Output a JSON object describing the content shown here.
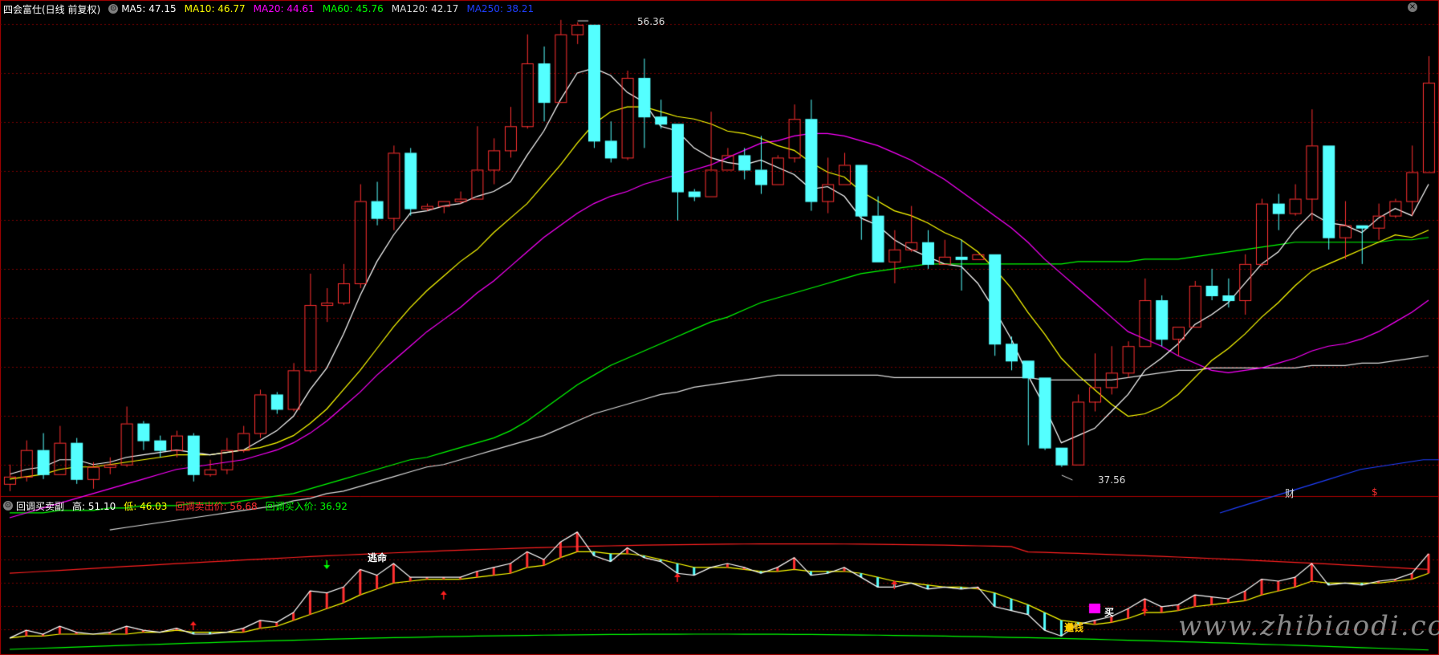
{
  "main_panel": {
    "title": "四会富仕(日线 前复权)",
    "ma": [
      {
        "label": "MA5: 47.15",
        "color": "#ffffff"
      },
      {
        "label": "MA10: 46.77",
        "color": "#ffff00"
      },
      {
        "label": "MA20: 44.61",
        "color": "#ff00ff"
      },
      {
        "label": "MA60: 45.76",
        "color": "#00ff00"
      },
      {
        "label": "MA120: 42.17",
        "color": "#dddddd"
      },
      {
        "label": "MA250: 38.21",
        "color": "#1f3fff"
      }
    ],
    "high_label": "56.36",
    "low_label": "37.56",
    "marker_cai": "财",
    "marker_dollar": "$"
  },
  "sub_panel": {
    "title": "回调买卖副",
    "high": "高: 51.10",
    "low": "低: 46.03",
    "sell_price": "回调卖出价: 56.68",
    "buy_price": "回调买入价: 36.92",
    "label_taoming": "逃命",
    "label_songqian": "送钱",
    "label_buy": "买"
  },
  "watermark": "www.zhibiaodi.com",
  "colors": {
    "up": "#ff3030",
    "down": "#54ffff",
    "grid": "#7a0000",
    "ma5": "#ffffff",
    "ma10": "#ffff00",
    "ma20": "#ff00ff",
    "ma60": "#00ff00",
    "ma120": "#dddddd",
    "ma250": "#1f3fff"
  },
  "candles": [
    [
      37.2,
      37.5,
      38.0,
      36.9
    ],
    [
      37.5,
      38.6,
      39.0,
      37.3
    ],
    [
      38.6,
      37.6,
      39.3,
      37.4
    ],
    [
      37.6,
      38.9,
      39.6,
      37.6
    ],
    [
      38.9,
      37.4,
      39.1,
      37.2
    ],
    [
      37.4,
      37.9,
      38.1,
      37.0
    ],
    [
      37.9,
      38.0,
      38.3,
      37.6
    ],
    [
      38.0,
      39.7,
      40.4,
      37.9
    ],
    [
      39.7,
      39.0,
      39.8,
      38.6
    ],
    [
      39.0,
      38.6,
      39.2,
      38.3
    ],
    [
      38.6,
      39.2,
      39.4,
      38.3
    ],
    [
      39.2,
      37.6,
      39.3,
      37.3
    ],
    [
      37.6,
      37.8,
      38.2,
      37.5
    ],
    [
      37.8,
      38.6,
      39.1,
      37.6
    ],
    [
      38.6,
      39.3,
      39.6,
      38.5
    ],
    [
      39.3,
      40.9,
      41.1,
      39.1
    ],
    [
      40.9,
      40.3,
      41.0,
      40.1
    ],
    [
      40.3,
      41.9,
      42.2,
      40.2
    ],
    [
      41.9,
      44.6,
      45.9,
      41.8
    ],
    [
      44.6,
      44.7,
      45.3,
      43.9
    ],
    [
      44.7,
      45.5,
      46.3,
      44.6
    ],
    [
      45.5,
      48.9,
      49.6,
      45.3
    ],
    [
      48.9,
      48.2,
      49.7,
      47.9
    ],
    [
      48.2,
      50.9,
      51.2,
      47.7
    ],
    [
      50.9,
      48.6,
      51.1,
      48.3
    ],
    [
      48.6,
      48.7,
      48.8,
      48.5
    ],
    [
      48.7,
      48.9,
      48.9,
      48.4
    ],
    [
      48.9,
      49.0,
      49.3,
      48.8
    ],
    [
      49.0,
      50.2,
      52.0,
      49.0
    ],
    [
      50.2,
      51.0,
      51.5,
      49.6
    ],
    [
      51.0,
      52.0,
      52.8,
      50.7
    ],
    [
      52.0,
      54.6,
      55.8,
      51.9
    ],
    [
      54.6,
      53.0,
      55.3,
      52.2
    ],
    [
      53.0,
      55.8,
      56.4,
      53.0
    ],
    [
      55.8,
      56.2,
      56.3,
      55.4
    ],
    [
      56.2,
      51.4,
      56.2,
      51.1
    ],
    [
      51.4,
      50.7,
      52.2,
      50.5
    ],
    [
      50.7,
      54.0,
      54.3,
      50.6
    ],
    [
      54.0,
      52.4,
      54.8,
      51.1
    ],
    [
      52.4,
      52.1,
      53.1,
      51.9
    ],
    [
      52.1,
      49.3,
      50.2,
      48.1
    ],
    [
      49.3,
      49.1,
      49.4,
      48.9
    ],
    [
      49.1,
      50.2,
      52.6,
      49.1
    ],
    [
      50.2,
      50.8,
      51.1,
      50.6
    ],
    [
      50.8,
      50.2,
      51.1,
      49.8
    ],
    [
      50.2,
      49.6,
      51.6,
      49.2
    ],
    [
      49.6,
      50.7,
      50.8,
      49.7
    ],
    [
      50.7,
      52.3,
      52.9,
      50.5
    ],
    [
      52.3,
      48.9,
      53.1,
      48.5
    ],
    [
      48.9,
      49.6,
      50.7,
      48.4
    ],
    [
      49.6,
      50.4,
      50.9,
      49.6
    ],
    [
      50.4,
      48.3,
      49.6,
      47.3
    ],
    [
      48.3,
      46.4,
      49.1,
      46.4
    ],
    [
      46.4,
      46.9,
      47.7,
      45.5
    ],
    [
      46.9,
      47.2,
      48.7,
      46.8
    ],
    [
      47.2,
      46.3,
      47.7,
      46.1
    ],
    [
      46.3,
      46.6,
      47.3,
      46.6
    ],
    [
      46.6,
      46.5,
      47.3,
      45.2
    ],
    [
      46.5,
      46.7,
      46.6,
      46.7
    ],
    [
      46.7,
      43.0,
      44.0,
      42.5
    ],
    [
      43.0,
      42.3,
      43.3,
      41.9
    ],
    [
      42.3,
      41.6,
      40.2,
      38.8
    ],
    [
      41.6,
      38.7,
      39.0,
      38.6
    ],
    [
      38.7,
      38.0,
      38.2,
      37.9
    ],
    [
      38.0,
      40.6,
      40.9,
      39.9
    ],
    [
      40.6,
      41.2,
      42.6,
      40.2
    ],
    [
      41.2,
      41.8,
      42.9,
      40.9
    ],
    [
      41.8,
      42.9,
      43.1,
      41.6
    ],
    [
      42.9,
      44.8,
      45.7,
      44.1
    ],
    [
      44.8,
      43.2,
      45.0,
      42.9
    ],
    [
      43.2,
      43.7,
      43.7,
      42.5
    ],
    [
      43.7,
      45.4,
      45.6,
      44.0
    ],
    [
      45.4,
      45.0,
      46.1,
      44.8
    ],
    [
      45.0,
      44.8,
      45.7,
      44.5
    ],
    [
      44.8,
      46.3,
      46.7,
      44.2
    ],
    [
      46.3,
      48.8,
      49.0,
      46.2
    ],
    [
      48.8,
      48.4,
      49.2,
      47.7
    ],
    [
      48.4,
      49.0,
      49.6,
      48.3
    ],
    [
      49.0,
      51.2,
      52.7,
      48.1
    ],
    [
      51.2,
      47.4,
      49.8,
      46.9
    ],
    [
      47.4,
      47.9,
      48.9,
      46.5
    ],
    [
      47.9,
      47.8,
      47.9,
      46.3
    ],
    [
      47.8,
      48.3,
      48.8,
      47.3
    ],
    [
      48.3,
      48.9,
      49.0,
      48.2
    ],
    [
      48.9,
      50.1,
      51.2,
      48.3
    ],
    [
      50.1,
      53.8,
      54.9,
      50.1
    ]
  ],
  "ma_lines": {
    "ma5": [
      37.6,
      37.8,
      37.9,
      38.2,
      38.2,
      38.0,
      38.1,
      38.3,
      38.4,
      38.5,
      38.6,
      38.5,
      38.4,
      38.5,
      38.6,
      39.0,
      39.4,
      40.0,
      41.1,
      42.0,
      43.4,
      45.0,
      46.4,
      47.5,
      48.4,
      48.5,
      48.7,
      48.8,
      49.1,
      49.3,
      49.7,
      50.8,
      51.8,
      53.1,
      54.2,
      54.4,
      54.1,
      53.4,
      53.0,
      52.0,
      51.8,
      51.1,
      50.7,
      50.5,
      50.4,
      50.6,
      50.3,
      50.0,
      49.4,
      49.5,
      49.1,
      48.2,
      47.9,
      47.3,
      46.9,
      46.6,
      46.3,
      46.2,
      45.5,
      44.4,
      43.2,
      41.7,
      40.4,
      38.9,
      39.2,
      39.5,
      40.2,
      40.9,
      41.9,
      42.4,
      43.0,
      43.8,
      44.2,
      44.7,
      45.5,
      46.3,
      46.8,
      47.7,
      48.4,
      48.0,
      47.9,
      47.6,
      48.2,
      48.6,
      48.3,
      49.6
    ],
    "ma10": [
      37.4,
      37.5,
      37.6,
      37.8,
      37.9,
      37.9,
      38.0,
      38.1,
      38.2,
      38.3,
      38.4,
      38.4,
      38.4,
      38.5,
      38.6,
      38.7,
      38.9,
      39.2,
      39.7,
      40.3,
      41.1,
      41.9,
      42.8,
      43.7,
      44.5,
      45.2,
      45.8,
      46.4,
      46.9,
      47.6,
      48.2,
      48.8,
      49.6,
      50.4,
      51.3,
      52.1,
      52.6,
      52.8,
      52.8,
      52.6,
      52.4,
      52.3,
      52.1,
      51.8,
      51.7,
      51.5,
      51.2,
      51.0,
      50.5,
      50.1,
      49.9,
      49.3,
      48.9,
      48.5,
      48.3,
      48.0,
      47.6,
      47.3,
      46.8,
      46.1,
      45.3,
      44.3,
      43.4,
      42.4,
      41.7,
      41.1,
      40.5,
      40.0,
      40.1,
      40.4,
      40.9,
      41.6,
      42.3,
      42.8,
      43.4,
      44.1,
      44.7,
      45.4,
      46.0,
      46.3,
      46.6,
      46.9,
      47.2,
      47.5,
      47.4,
      47.7
    ],
    "ma20": [
      35.8,
      36.0,
      36.2,
      36.4,
      36.6,
      36.8,
      37.0,
      37.2,
      37.4,
      37.6,
      37.8,
      37.9,
      38.0,
      38.1,
      38.2,
      38.4,
      38.6,
      38.9,
      39.3,
      39.8,
      40.4,
      41.0,
      41.7,
      42.3,
      42.9,
      43.5,
      44.0,
      44.5,
      45.1,
      45.6,
      46.2,
      46.8,
      47.4,
      47.9,
      48.4,
      48.8,
      49.1,
      49.3,
      49.6,
      49.8,
      50.0,
      50.2,
      50.4,
      50.7,
      51.0,
      51.3,
      51.4,
      51.6,
      51.7,
      51.7,
      51.6,
      51.4,
      51.2,
      50.9,
      50.6,
      50.2,
      49.8,
      49.3,
      48.8,
      48.3,
      47.8,
      47.2,
      46.5,
      45.9,
      45.3,
      44.7,
      44.1,
      43.5,
      43.2,
      42.9,
      42.5,
      42.2,
      41.9,
      41.8,
      41.9,
      42.0,
      42.2,
      42.4,
      42.7,
      42.9,
      43.0,
      43.2,
      43.5,
      43.9,
      44.3,
      44.8
    ],
    "ma60": [
      36.0,
      36.0,
      36.0,
      36.1,
      36.1,
      36.1,
      36.2,
      36.2,
      36.3,
      36.3,
      36.3,
      36.4,
      36.4,
      36.4,
      36.5,
      36.6,
      36.7,
      36.8,
      37.0,
      37.2,
      37.4,
      37.6,
      37.8,
      38.0,
      38.2,
      38.3,
      38.5,
      38.7,
      38.9,
      39.1,
      39.4,
      39.8,
      40.3,
      40.8,
      41.3,
      41.7,
      42.1,
      42.4,
      42.7,
      43.0,
      43.3,
      43.6,
      43.9,
      44.1,
      44.4,
      44.7,
      44.9,
      45.1,
      45.3,
      45.5,
      45.7,
      45.9,
      46.0,
      46.1,
      46.2,
      46.3,
      46.3,
      46.3,
      46.3,
      46.3,
      46.3,
      46.3,
      46.3,
      46.3,
      46.4,
      46.4,
      46.4,
      46.4,
      46.5,
      46.5,
      46.5,
      46.6,
      46.7,
      46.8,
      46.9,
      47.0,
      47.1,
      47.2,
      47.2,
      47.2,
      47.2,
      47.2,
      47.2,
      47.3,
      47.3,
      47.4
    ],
    "ma120": [
      null,
      null,
      null,
      null,
      null,
      null,
      35.3,
      35.4,
      35.5,
      35.6,
      35.7,
      35.8,
      35.9,
      36.0,
      36.1,
      36.2,
      36.3,
      36.5,
      36.6,
      36.8,
      36.9,
      37.1,
      37.3,
      37.5,
      37.7,
      37.9,
      38.0,
      38.2,
      38.4,
      38.6,
      38.8,
      39.0,
      39.2,
      39.5,
      39.8,
      40.1,
      40.3,
      40.5,
      40.7,
      40.9,
      41.0,
      41.2,
      41.3,
      41.4,
      41.5,
      41.6,
      41.7,
      41.7,
      41.7,
      41.7,
      41.7,
      41.7,
      41.7,
      41.6,
      41.6,
      41.6,
      41.6,
      41.6,
      41.6,
      41.6,
      41.6,
      41.6,
      41.5,
      41.5,
      41.5,
      41.5,
      41.5,
      41.6,
      41.7,
      41.8,
      41.9,
      41.9,
      42.0,
      42.0,
      42.0,
      42.0,
      42.0,
      42.0,
      42.1,
      42.1,
      42.1,
      42.2,
      42.2,
      42.3,
      42.4,
      42.5
    ],
    "ma250": [
      36.0,
      36.2,
      36.4,
      36.6,
      36.8,
      37.0,
      37.2,
      37.4,
      37.6,
      37.8,
      37.9,
      38.0,
      38.1,
      38.2,
      38.2
    ]
  },
  "sub_series": {
    "price": [
      50.0,
      50.4,
      50.2,
      50.6,
      50.3,
      50.2,
      50.3,
      50.6,
      50.4,
      50.3,
      50.5,
      50.2,
      50.2,
      50.3,
      50.5,
      50.9,
      50.8,
      51.3,
      52.4,
      52.3,
      52.6,
      53.5,
      53.2,
      53.8,
      53.1,
      53.1,
      53.1,
      53.1,
      53.4,
      53.6,
      53.8,
      54.4,
      54.0,
      54.9,
      55.4,
      54.2,
      53.9,
      54.6,
      54.1,
      53.9,
      53.3,
      53.2,
      53.6,
      53.8,
      53.6,
      53.3,
      53.6,
      54.1,
      53.2,
      53.3,
      53.6,
      53.1,
      52.6,
      52.6,
      52.8,
      52.5,
      52.6,
      52.5,
      52.6,
      51.6,
      51.4,
      51.2,
      50.4,
      50.1,
      50.7,
      50.9,
      51.1,
      51.5,
      52.0,
      51.6,
      51.7,
      52.2,
      52.1,
      52.0,
      52.4,
      53.0,
      52.9,
      53.1,
      53.8,
      52.7,
      52.8,
      52.7,
      52.9,
      53.0,
      53.3,
      54.3
    ],
    "base": [
      50.0,
      50.1,
      50.1,
      50.2,
      50.2,
      50.2,
      50.2,
      50.2,
      50.3,
      50.3,
      50.4,
      50.3,
      50.3,
      50.3,
      50.3,
      50.5,
      50.6,
      50.9,
      51.2,
      51.5,
      51.8,
      52.2,
      52.5,
      52.8,
      52.9,
      53.0,
      53.0,
      53.0,
      53.1,
      53.2,
      53.3,
      53.6,
      53.7,
      54.1,
      54.4,
      54.4,
      54.3,
      54.3,
      54.2,
      54.0,
      53.8,
      53.6,
      53.6,
      53.6,
      53.5,
      53.4,
      53.4,
      53.5,
      53.4,
      53.4,
      53.4,
      53.3,
      53.1,
      52.9,
      52.8,
      52.7,
      52.6,
      52.6,
      52.5,
      52.3,
      52.0,
      51.7,
      51.3,
      50.9,
      50.8,
      50.7,
      50.8,
      51.0,
      51.3,
      51.3,
      51.4,
      51.6,
      51.7,
      51.8,
      51.9,
      52.2,
      52.4,
      52.6,
      52.9,
      52.8,
      52.8,
      52.8,
      52.8,
      52.9,
      53.0,
      53.3
    ]
  }
}
